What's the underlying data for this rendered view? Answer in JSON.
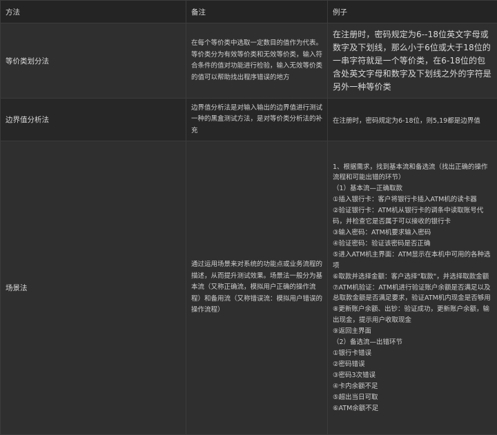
{
  "table": {
    "headers": [
      "方法",
      "备注",
      "例子"
    ],
    "rows": [
      {
        "method": "等价类划分法",
        "note": "在每个等价类中选取一定数目的值作为代表。等价类分为有效等价类和无效等价类，输入符合条件的值对功能进行检验，输入无效等价类的值可以帮助找出程序错误的地方",
        "example": "在注册时，密码规定为6--18位英文字母或数字及下划线，那么小于6位或大于18位的一串字符就是一个等价类，在6-18位的包含处英文字母和数字及下划线之外的字符是另外一种等价类"
      },
      {
        "method": "边界值分析法",
        "note": "边界值分析法是对输入输出的边界值进行测试一种的黑盒测试方法，是对等价类分析法的补充",
        "example": "在注册时，密码规定为6-18位，则5,19都是边界值"
      },
      {
        "method": "场景法",
        "note": "通过运用场景来对系统的功能点或业务流程的描述，从而提升测试效果。场景法一般分为基本流（又称正确流，模拟用户正确的操作流程）和备用流（又称错误流：模拟用户错误的操作流程）",
        "example_lines": [
          "1、根据需求，找到基本流和备选流（找出正确的操作流程和可能出错的环节）",
          "（1）基本流—正确取款",
          "①插入银行卡：客户将银行卡插入ATM机的读卡器",
          "②验证银行卡：ATM机从银行卡的调条中读取账号代码，并检查它是否属于可以接收的银行卡",
          "③输入密码：ATM机要求输入密码",
          "④验证密码：验证该密码是否正确",
          "⑤进入ATM机主界面：ATM显示在本机中可用的各种选项",
          "⑥取款并选择金额：客户选择\"取款\"，并选择取款金额",
          "⑦ATM机验证：ATM机进行验证账户余额是否满足以及总取款金额是否满足要求，验证ATM机内现金是否够用",
          "⑧更新账户余额、出钞：验证成功，更新账户余额，输出现金，提示用户收取现金",
          "⑨返回主界面",
          "（2）备选流—出错环节",
          "①银行卡错误",
          "②密码错误",
          "③密码3次错误",
          "④卡内余额不足",
          "⑤超出当日可取",
          "⑥ATM余额不足"
        ]
      }
    ]
  }
}
